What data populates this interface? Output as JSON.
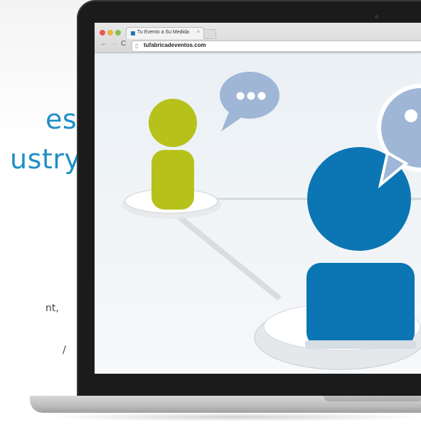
{
  "marketing": {
    "headline_line1": "est",
    "headline_line2": "ustry",
    "body_fragment1": "nt,",
    "body_fragment2": "/"
  },
  "browser": {
    "tab_title": "Tu Evento a Su Medida",
    "tab_close": "×",
    "url": "tufabricadeventos.com",
    "nav": {
      "back": "←",
      "forward": "→",
      "reload": "C",
      "page_icon": "▯"
    }
  },
  "colors": {
    "accent_blue": "#1e8fc8",
    "person_green": "#b6c21a",
    "person_blue": "#0b76b3",
    "bubble": "#9fb6d6"
  },
  "icons": [
    "traffic-light-close-icon",
    "traffic-light-minimize-icon",
    "traffic-light-zoom-icon",
    "back-arrow-icon",
    "forward-arrow-icon",
    "reload-icon",
    "page-icon",
    "speech-bubble-icon",
    "person-icon"
  ]
}
